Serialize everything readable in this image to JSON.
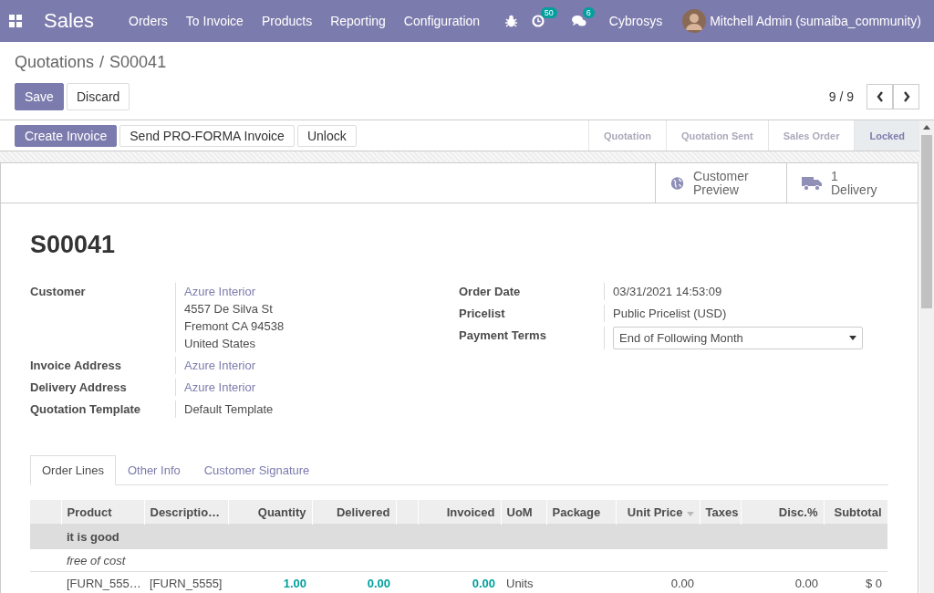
{
  "navbar": {
    "app_title": "Sales",
    "menu": [
      "Orders",
      "To Invoice",
      "Products",
      "Reporting",
      "Configuration"
    ],
    "systray": [
      {
        "kind": "bug"
      },
      {
        "kind": "activity",
        "badge": "50"
      },
      {
        "kind": "chat",
        "badge": "6"
      }
    ],
    "company": "Cybrosys",
    "user": "Mitchell Admin (sumaiba_community)"
  },
  "breadcrumb": {
    "items": [
      "Quotations",
      "S00041"
    ],
    "separator": "/"
  },
  "buttons": [
    {
      "label": "Save",
      "kind": "primary"
    },
    {
      "label": "Discard",
      "kind": "secondary"
    }
  ],
  "pager": {
    "value": "9 / 9"
  },
  "header_buttons": [
    {
      "label": "Create Invoice",
      "kind": "primary"
    },
    {
      "label": "Send PRO-FORMA Invoice",
      "kind": "secondary"
    },
    {
      "label": "Unlock",
      "kind": "secondary"
    }
  ],
  "stages": [
    {
      "label": "Quotation",
      "selected": false
    },
    {
      "label": "Quotation Sent",
      "selected": false
    },
    {
      "label": "Sales Order",
      "selected": false
    },
    {
      "label": "Locked",
      "selected": true
    }
  ],
  "smart_buttons": [
    {
      "kind": "globe",
      "label": "Customer Preview"
    },
    {
      "kind": "truck",
      "count": "1",
      "label": "Delivery"
    }
  ],
  "title": "S00041",
  "left_fields": [
    {
      "label": "Customer",
      "lines": [
        {
          "text": "Azure Interior",
          "kind": "link"
        },
        {
          "text": "4557 De Silva St",
          "kind": "text"
        },
        {
          "text": "Fremont CA 94538",
          "kind": "text"
        },
        {
          "text": "United States",
          "kind": "text"
        }
      ]
    },
    {
      "label": "Invoice Address",
      "lines": [
        {
          "text": "Azure Interior",
          "kind": "link"
        }
      ]
    },
    {
      "label": "Delivery Address",
      "lines": [
        {
          "text": "Azure Interior",
          "kind": "link"
        }
      ]
    },
    {
      "label": "Quotation Template",
      "lines": [
        {
          "text": "Default Template",
          "kind": "text"
        }
      ]
    }
  ],
  "right_fields": [
    {
      "label": "Order Date",
      "kind": "text",
      "value": "03/31/2021 14:53:09"
    },
    {
      "label": "Pricelist",
      "kind": "text",
      "value": "Public Pricelist (USD)"
    },
    {
      "label": "Payment Terms",
      "kind": "select",
      "value": "End of Following Month"
    }
  ],
  "tabs": [
    {
      "label": "Order Lines",
      "selected": true
    },
    {
      "label": "Other Info",
      "selected": false
    },
    {
      "label": "Customer Signature",
      "selected": false
    }
  ],
  "table": {
    "columns": [
      {
        "label": "Product",
        "kind": "text"
      },
      {
        "label": "Descriptio…",
        "kind": "text"
      },
      {
        "label": "Quantity",
        "kind": "quantity"
      },
      {
        "label": "Delivered",
        "kind": "quantity"
      },
      {
        "kind": "number"
      },
      {
        "label": "Invoiced",
        "kind": "quantity"
      },
      {
        "label": "UoM",
        "kind": "text"
      },
      {
        "label": "Package",
        "kind": "text"
      },
      {
        "label": "Unit Price",
        "kind": "number",
        "sorted": true
      },
      {
        "label": "Taxes",
        "kind": "text"
      },
      {
        "label": "Disc.%",
        "kind": "number"
      },
      {
        "label": "Subtotal",
        "kind": "number"
      }
    ],
    "rows": [
      {
        "kind": "section",
        "text": "it is good"
      },
      {
        "kind": "note",
        "text": "free of cost"
      },
      {
        "kind": "line",
        "cells": [
          "[FURN_555…",
          "[FURN_5555]",
          "1.00",
          "0.00",
          null,
          "0.00",
          "Units",
          null,
          "0.00",
          null,
          "0.00",
          "$ 0"
        ]
      }
    ]
  }
}
